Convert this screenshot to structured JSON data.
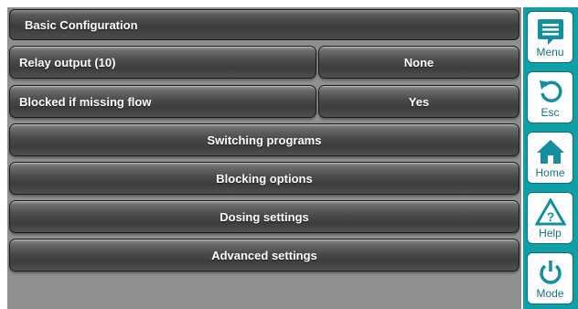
{
  "screen": {
    "title": "Basic Configuration",
    "rows": [
      {
        "label": "Relay output (10)",
        "value": "None"
      },
      {
        "label": "Blocked if missing flow",
        "value": "Yes"
      }
    ],
    "buttons": [
      "Switching programs",
      "Blocking options",
      "Dosing settings",
      "Advanced settings"
    ]
  },
  "sidebar": {
    "accent_color": "#0f9fa6",
    "items": [
      {
        "label": "Menu",
        "icon": "menu-icon"
      },
      {
        "label": "Esc",
        "icon": "esc-icon"
      },
      {
        "label": "Home",
        "icon": "home-icon"
      },
      {
        "label": "Help",
        "icon": "help-icon"
      },
      {
        "label": "Mode",
        "icon": "power-icon"
      }
    ]
  }
}
